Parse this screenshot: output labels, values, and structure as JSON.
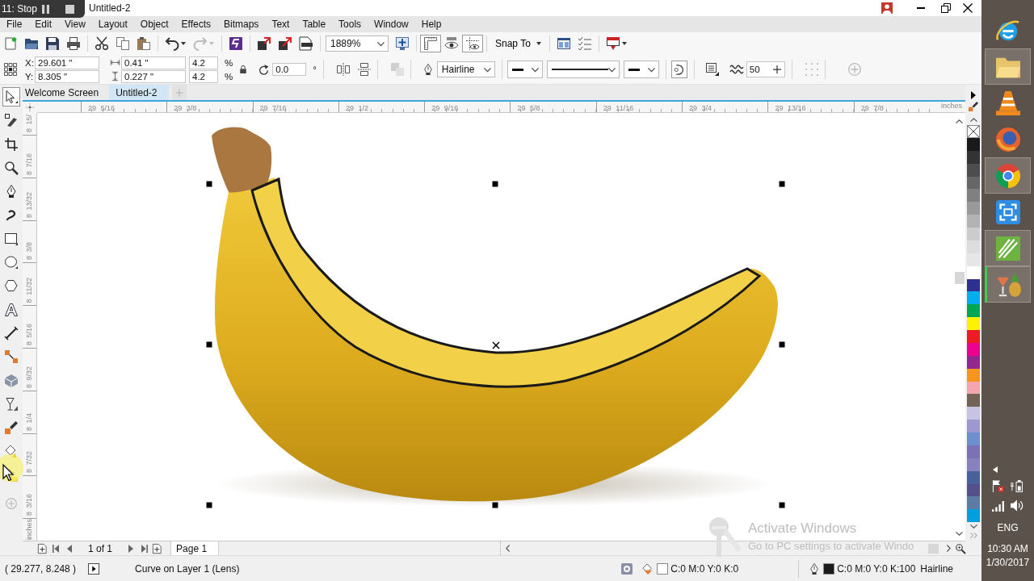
{
  "recorder": {
    "label": "11: Stop"
  },
  "window": {
    "title": "Untitled-2"
  },
  "menu": [
    "File",
    "Edit",
    "View",
    "Layout",
    "Object",
    "Effects",
    "Bitmaps",
    "Text",
    "Table",
    "Tools",
    "Window",
    "Help"
  ],
  "toolbar": {
    "file": [
      {
        "kind": "new",
        "disabled": false
      },
      {
        "kind": "open",
        "disabled": false
      },
      {
        "kind": "save",
        "disabled": false
      },
      {
        "kind": "print",
        "disabled": false
      }
    ],
    "edit": [
      {
        "kind": "cut",
        "disabled": false
      },
      {
        "kind": "copy",
        "disabled": false
      },
      {
        "kind": "paste",
        "disabled": false
      }
    ],
    "history": [
      {
        "kind": "undo",
        "disabled": false
      },
      {
        "kind": "redo",
        "disabled": true
      }
    ],
    "transfer": [
      {
        "kind": "connect",
        "disabled": false
      },
      {
        "kind": "import",
        "disabled": false
      },
      {
        "kind": "export",
        "disabled": false
      },
      {
        "kind": "publish-pdf",
        "disabled": false
      }
    ],
    "zoom": "1889%",
    "view": [
      {
        "kind": "full-screen",
        "on": false
      },
      {
        "kind": "rulers",
        "on": true
      },
      {
        "kind": "preview",
        "on": false
      },
      {
        "kind": "guidelines",
        "on": true
      }
    ],
    "snap": "Snap To",
    "extras": [
      {
        "kind": "options"
      },
      {
        "kind": "launcher"
      },
      {
        "kind": "welcome"
      }
    ]
  },
  "properties": {
    "position": [
      {
        "label": "X:",
        "value": "29.601 \""
      },
      {
        "label": "Y:",
        "value": "8.305 \""
      }
    ],
    "size": [
      "0.41 \"",
      "0.227 \""
    ],
    "scale": [
      {
        "value": "4.2",
        "unit": "%"
      },
      {
        "value": "4.2",
        "unit": "%"
      }
    ],
    "rotation": {
      "value": "0.0",
      "unit": "°"
    },
    "outline_width": "Hairline",
    "smoothing": "50"
  },
  "tabs": [
    {
      "label": "Welcome Screen",
      "selected": false
    },
    {
      "label": "Untitled-2",
      "selected": true
    }
  ],
  "rulers": {
    "horizontal": [
      "29 5/16",
      "29 3/8",
      "29 7/16",
      "29 1/2",
      "29 9/16",
      "29 5/8",
      "29 11/16",
      "29 3/4",
      "29 13/16",
      "29 7/8"
    ],
    "horizontal_unit": "inches",
    "vertical": [
      "8 15/",
      "8 7/16",
      "8 13/32",
      "8 3/8",
      "8 11/32",
      "8 5/16",
      "8 9/32",
      "8 1/4",
      "8 7/32",
      "8 3/16"
    ],
    "vertical_unit": "inches"
  },
  "toolbox": [
    {
      "kind": "pick",
      "selected": true
    },
    {
      "kind": "shape",
      "selected": false
    },
    {
      "kind": "crop",
      "selected": false
    },
    {
      "kind": "zoom",
      "selected": false
    },
    {
      "kind": "freehand",
      "selected": false
    },
    {
      "kind": "artistic",
      "selected": false
    },
    {
      "kind": "rectangle",
      "selected": false
    },
    {
      "kind": "ellipse",
      "selected": false
    },
    {
      "kind": "polygon",
      "selected": false
    },
    {
      "kind": "text",
      "selected": false
    },
    {
      "kind": "dimension",
      "selected": false
    },
    {
      "kind": "connector",
      "selected": false
    },
    {
      "kind": "extrude",
      "selected": false
    },
    {
      "kind": "transparency",
      "selected": false
    },
    {
      "kind": "eyedropper",
      "selected": false
    },
    {
      "kind": "fill",
      "selected": false
    },
    {
      "kind": "smart-fill",
      "selected": false
    }
  ],
  "palette": [
    {
      "kind": "none"
    },
    {
      "kind": "color",
      "color": "#1a1a1a"
    },
    {
      "kind": "color",
      "color": "#333333"
    },
    {
      "kind": "color",
      "color": "#4d4d4d"
    },
    {
      "kind": "color",
      "color": "#666666"
    },
    {
      "kind": "color",
      "color": "#808080"
    },
    {
      "kind": "color",
      "color": "#999999"
    },
    {
      "kind": "color",
      "color": "#b3b3b3"
    },
    {
      "kind": "color",
      "color": "#cccccc"
    },
    {
      "kind": "color",
      "color": "#dddddd"
    },
    {
      "kind": "color",
      "color": "#e6e6e6"
    },
    {
      "kind": "color",
      "color": "#ffffff"
    },
    {
      "kind": "color",
      "color": "#2e3192"
    },
    {
      "kind": "color",
      "color": "#00aeef"
    },
    {
      "kind": "color",
      "color": "#00a651"
    },
    {
      "kind": "color",
      "color": "#fff200"
    },
    {
      "kind": "color",
      "color": "#ed1c24"
    },
    {
      "kind": "color",
      "color": "#ec008c"
    },
    {
      "kind": "color",
      "color": "#92278f"
    },
    {
      "kind": "color",
      "color": "#f7941d"
    },
    {
      "kind": "color",
      "color": "#f4a5ae"
    },
    {
      "kind": "color",
      "color": "#736357"
    },
    {
      "kind": "color",
      "color": "#c7c3e3"
    },
    {
      "kind": "color",
      "color": "#9e98d0"
    },
    {
      "kind": "color",
      "color": "#6d8fd0"
    },
    {
      "kind": "color",
      "color": "#7a72b5"
    },
    {
      "kind": "color",
      "color": "#8782bd"
    },
    {
      "kind": "color",
      "color": "#48609c"
    },
    {
      "kind": "color",
      "color": "#54508a"
    },
    {
      "kind": "color",
      "color": "#5d7ca3"
    },
    {
      "kind": "color",
      "color": "#00a0e0"
    }
  ],
  "page_nav": {
    "count": "1 of 1",
    "pages": [
      {
        "label": "Page 1",
        "selected": true
      }
    ]
  },
  "status": {
    "coordinates": "( 29.277, 8.248 )",
    "object": "Curve on Layer 1 (Lens)",
    "fill": {
      "color": "#ffffff",
      "label": "C:0 M:0 Y:0 K:0"
    },
    "outline": {
      "color": "#1a1a1a",
      "label": "C:0 M:0 Y:0 K:100",
      "width": "Hairline"
    }
  },
  "activation": {
    "title": "Activate Windows",
    "message": "Go to PC settings to activate Windo"
  },
  "taskbar": {
    "apps": [
      {
        "kind": "ie",
        "open": false,
        "attention": false
      },
      {
        "kind": "explorer",
        "open": true,
        "attention": false
      },
      {
        "kind": "vlc",
        "open": false,
        "attention": false
      },
      {
        "kind": "firefox",
        "open": false,
        "attention": false
      },
      {
        "kind": "chrome",
        "open": true,
        "attention": false
      },
      {
        "kind": "capture",
        "open": false,
        "attention": false
      },
      {
        "kind": "corel",
        "open": true,
        "attention": false
      },
      {
        "kind": "cocktail",
        "open": true,
        "attention": true
      }
    ],
    "language": "ENG",
    "time": "10:30 AM",
    "date": "1/30/2017"
  }
}
